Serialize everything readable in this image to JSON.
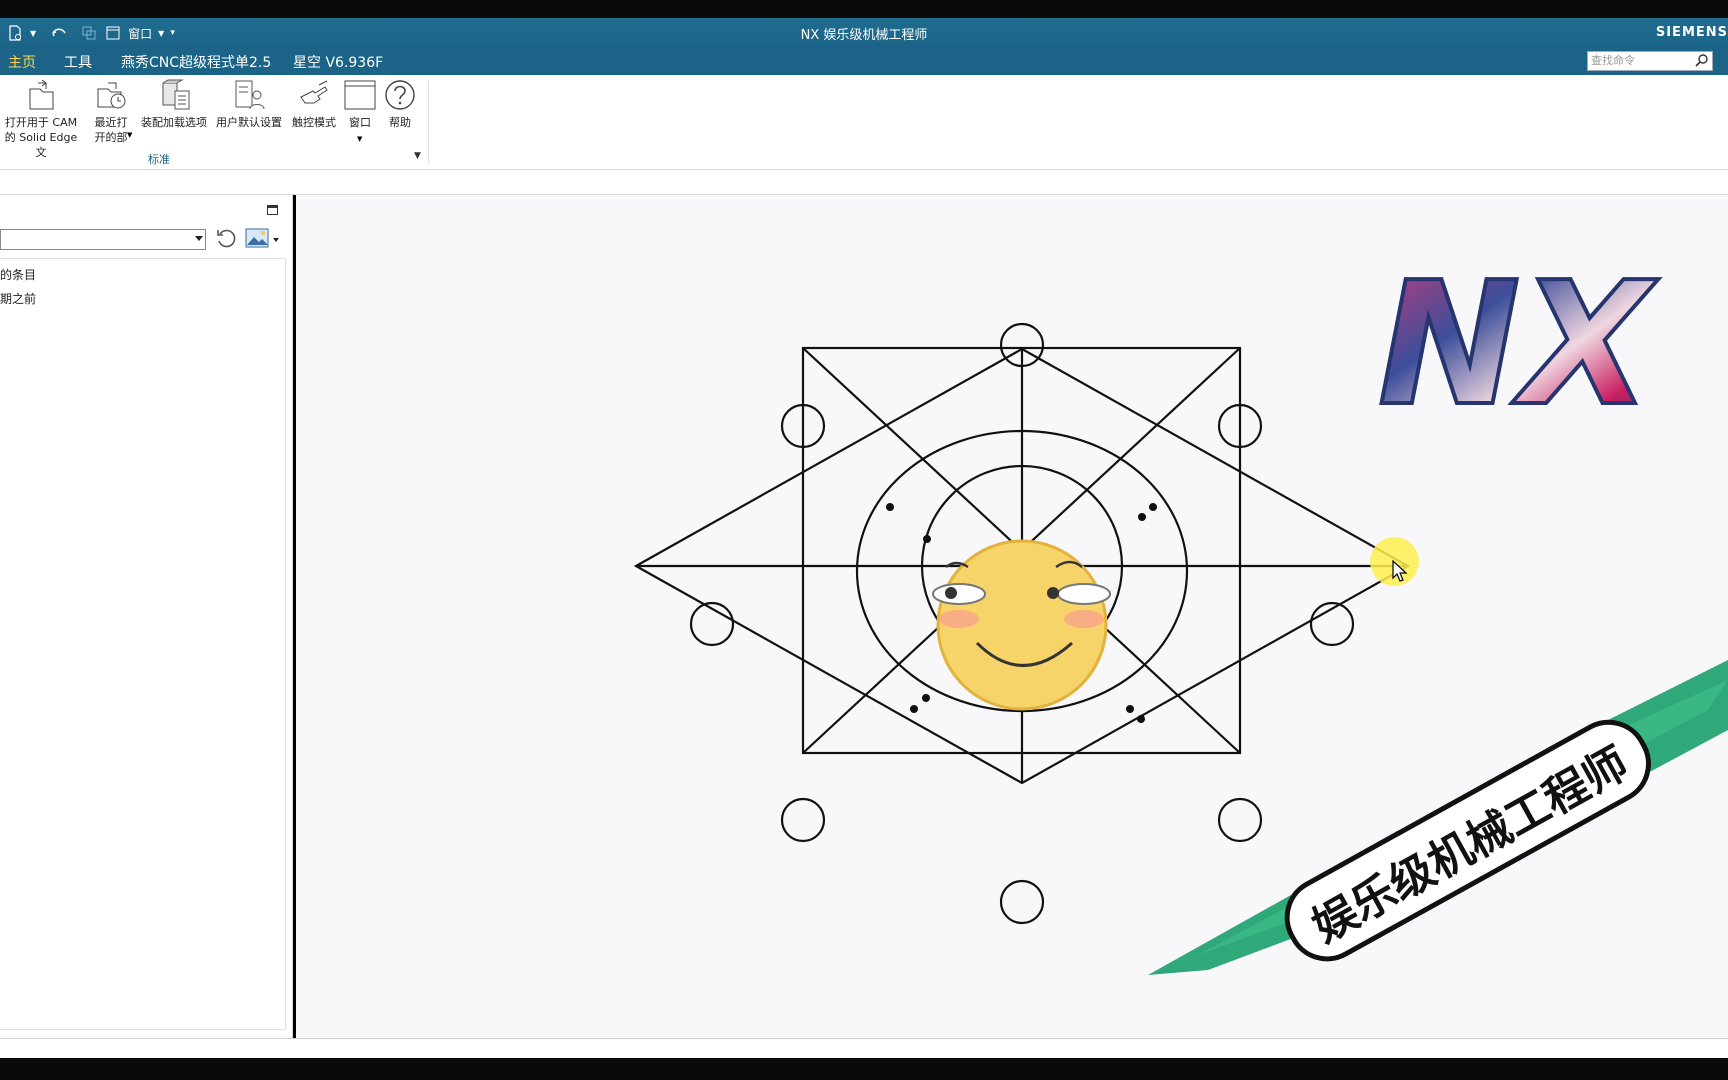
{
  "window": {
    "title": "NX 娱乐级机械工程师",
    "brand": "SIEMENS",
    "qat_window_label": "窗口"
  },
  "tabs": [
    {
      "label": "主页",
      "active": true
    },
    {
      "label": "工具",
      "active": false
    },
    {
      "label": "燕秀CNC超级程式单2.5",
      "active": false
    },
    {
      "label": "星空 V6.936F",
      "active": false
    }
  ],
  "search": {
    "placeholder": "查找命令"
  },
  "ribbon": {
    "buttons": [
      {
        "line1": "打开用于 CAM",
        "line2": "的 Solid Edge 文"
      },
      {
        "line1": "最近打",
        "line2": "开的部"
      },
      {
        "line1": "装配加载选项",
        "line2": ""
      },
      {
        "line1": "用户默认设置",
        "line2": ""
      },
      {
        "line1": "触控模式",
        "line2": ""
      },
      {
        "line1": "窗口",
        "line2": ""
      },
      {
        "line1": "帮助",
        "line2": ""
      }
    ],
    "group_label": "标准"
  },
  "nav_panel": {
    "items": [
      "的条目",
      "期之前"
    ]
  },
  "canvas": {
    "nx_logo": "NX",
    "banner_text": "娱乐级机械工程师"
  },
  "colors": {
    "title_bg": "#1b6487",
    "active_tab": "#ffd34d",
    "banner_green": "#2fa87a",
    "smiley": "#f7d46a"
  }
}
